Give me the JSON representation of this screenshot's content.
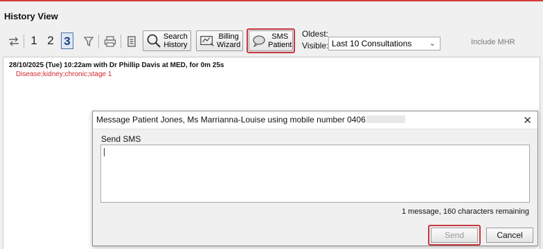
{
  "window": {
    "title": "History View",
    "accent_color": "#d73a3a"
  },
  "toolbar": {
    "swap_icon": "swap-arrows-icon",
    "levels": [
      "1",
      "2",
      "3"
    ],
    "active_level": "3",
    "filter_icon": "filter-icon",
    "print_icon": "printer-icon",
    "doc_icon": "document-icon",
    "search_history_label_1": "Search",
    "search_history_label_2": "History",
    "billing_wizard_label_1": "Billing",
    "billing_wizard_label_2": "Wizard",
    "sms_patient_label_1": "SMS",
    "sms_patient_label_2": "Patient",
    "oldest_label": "Oldest:",
    "visible_label": "Visible:",
    "visible_value": "Last 10 Consultations",
    "include_mhr_label": "Include MHR",
    "highlight_color": "#c8353f"
  },
  "history": {
    "entries": [
      {
        "header": "28/10/2025 (Tue) 10:22am with Dr Phillip Davis at MED, for 0m 25s",
        "diagnosis": "Disease;kidney;chronic;stage 1"
      }
    ]
  },
  "sms_dialog": {
    "title": "Message Patient Jones, Ms Marrianna-Louise using mobile number 0406",
    "send_sms_label": "Send SMS",
    "message_value": "",
    "remaining_text": "1 message, 160 characters remaining",
    "send_button": "Send",
    "cancel_button": "Cancel",
    "close_icon": "close-icon"
  }
}
